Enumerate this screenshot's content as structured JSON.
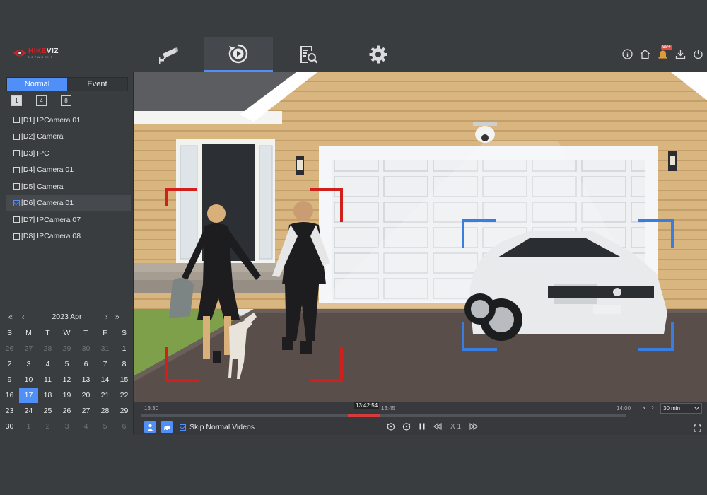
{
  "brand": {
    "name_red": "HIKE",
    "name_white": "VIZ",
    "tagline": "NETWORKS"
  },
  "nav": {
    "tabs": [
      {
        "icon": "cctv-camera-icon",
        "active": false
      },
      {
        "icon": "playback-icon",
        "active": true
      },
      {
        "icon": "file-search-icon",
        "active": false
      },
      {
        "icon": "gear-icon",
        "active": false
      }
    ]
  },
  "tools": {
    "notification_count": "99+",
    "icons": [
      "info-icon",
      "home-icon",
      "alarm-bell-icon",
      "download-icon",
      "power-icon"
    ]
  },
  "mode_tabs": {
    "normal": "Normal",
    "event": "Event",
    "active": "Normal"
  },
  "splits": [
    "1",
    "4",
    "8"
  ],
  "cameras": [
    {
      "label": "[D1] IPCamera 01",
      "checked": false
    },
    {
      "label": "[D2] Camera",
      "checked": false
    },
    {
      "label": "[D3] IPC",
      "checked": false
    },
    {
      "label": "[D4] Camera 01",
      "checked": false
    },
    {
      "label": "[D5] Camera",
      "checked": false
    },
    {
      "label": "[D6] Camera 01",
      "checked": true
    },
    {
      "label": "[D7] IPCamera 07",
      "checked": false
    },
    {
      "label": "[D8] IPCamera 08",
      "checked": false
    }
  ],
  "calendar": {
    "prev_year": "«",
    "prev_month": "‹",
    "title": "2023 Apr",
    "next_month": "›",
    "next_year": "»",
    "weekdays": [
      "S",
      "M",
      "T",
      "W",
      "T",
      "F",
      "S"
    ],
    "days": [
      {
        "d": "26",
        "out": true
      },
      {
        "d": "27",
        "out": true
      },
      {
        "d": "28",
        "out": true
      },
      {
        "d": "29",
        "out": true
      },
      {
        "d": "30",
        "out": true
      },
      {
        "d": "31",
        "out": true
      },
      {
        "d": "1"
      },
      {
        "d": "2"
      },
      {
        "d": "3"
      },
      {
        "d": "4"
      },
      {
        "d": "5"
      },
      {
        "d": "6"
      },
      {
        "d": "7"
      },
      {
        "d": "8"
      },
      {
        "d": "9"
      },
      {
        "d": "10"
      },
      {
        "d": "11"
      },
      {
        "d": "12"
      },
      {
        "d": "13"
      },
      {
        "d": "14"
      },
      {
        "d": "15"
      },
      {
        "d": "16"
      },
      {
        "d": "17",
        "today": true
      },
      {
        "d": "18"
      },
      {
        "d": "19"
      },
      {
        "d": "20"
      },
      {
        "d": "21"
      },
      {
        "d": "22"
      },
      {
        "d": "23"
      },
      {
        "d": "24"
      },
      {
        "d": "25"
      },
      {
        "d": "26"
      },
      {
        "d": "27"
      },
      {
        "d": "28"
      },
      {
        "d": "29"
      },
      {
        "d": "30"
      },
      {
        "d": "1",
        "out": true
      },
      {
        "d": "2",
        "out": true
      },
      {
        "d": "3",
        "out": true
      },
      {
        "d": "4",
        "out": true
      },
      {
        "d": "5",
        "out": true
      },
      {
        "d": "6",
        "out": true
      }
    ]
  },
  "timeline": {
    "start_label": "13:30",
    "mid_label": "13:45",
    "end_label": "14:00",
    "cursor_time": "13:42:54",
    "prev": "‹",
    "next": "›",
    "zoom": "30 min"
  },
  "controls": {
    "skip_label": "Skip Normal Videos",
    "skip_checked": true,
    "speed": "X 1",
    "filter_icons": [
      "person-icon",
      "vehicle-icon"
    ]
  },
  "colors": {
    "accent": "#4f8ff7",
    "human_box": "#d0201e",
    "vehicle_box": "#3a7de0",
    "record": "#d63a3a"
  }
}
